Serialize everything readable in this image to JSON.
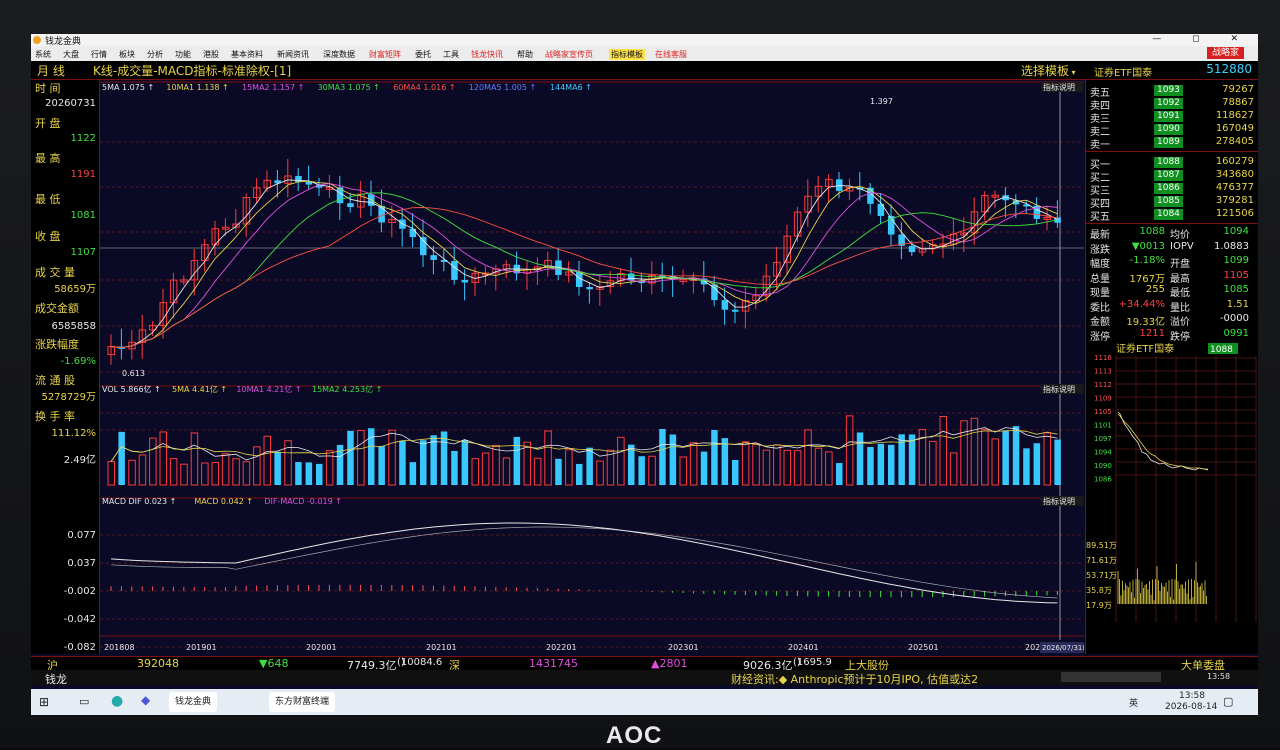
{
  "app": {
    "title": "钱龙金典",
    "window_controls": "— ◻ ✕"
  },
  "menu": {
    "items": [
      "系统",
      "大盘",
      "行情",
      "板块",
      "分析",
      "功能",
      "港股",
      "基本资料",
      "新闻资讯",
      "深度数据"
    ],
    "red_items": [
      "财富矩阵",
      "委托",
      "工具",
      "钱龙快讯",
      "帮助",
      "战略家宣传页"
    ],
    "highlighted": "指标模板",
    "extra": "在线客服",
    "login_label": "战略家"
  },
  "header": {
    "period": "月 线",
    "chart_title": "K线-成交量-MACD指标-标准除权-[1]",
    "template_label": "选择模板",
    "security_name": "证券ETF国泰",
    "security_code": "512880"
  },
  "ma_legend": [
    {
      "label": "5MA 1.075",
      "color": "#e8e8e8"
    },
    {
      "label": "10MA1 1.138",
      "color": "#e8d44a"
    },
    {
      "label": "15MA2 1.157",
      "color": "#e050e0"
    },
    {
      "label": "30MA3 1.075",
      "color": "#40e040"
    },
    {
      "label": "60MA4 1.016",
      "color": "#ff5040"
    },
    {
      "label": "120MA5 1.005",
      "color": "#6080ff"
    },
    {
      "label": "144MA6",
      "color": "#40c8ff"
    }
  ],
  "price_marks": {
    "high_label": "1.397",
    "low_label": "0.613"
  },
  "volume_legend": [
    {
      "label": "VOL 5.866亿",
      "color": "#e8e8e8"
    },
    {
      "label": "5MA 4.41亿",
      "color": "#e8d44a"
    },
    {
      "label": "10MA1 4.21亿",
      "color": "#e050e0"
    },
    {
      "label": "15MA2 4.253亿",
      "color": "#40e040"
    }
  ],
  "volume_axis": "2.49亿",
  "macd_legend": [
    {
      "label": "MACD DIF 0.023",
      "color": "#e8e8e8"
    },
    {
      "label": "MACD 0.042",
      "color": "#e8d44a"
    },
    {
      "label": "DIF-MACD -0.019",
      "color": "#e050e0"
    }
  ],
  "macd_axis": [
    "0.077",
    "0.037",
    "-0.002",
    "-0.042",
    "-0.082"
  ],
  "indicator_tag": "指标说明",
  "x_labels": [
    "201808",
    "201901",
    "202001",
    "202101",
    "202201",
    "202301",
    "202401",
    "202501",
    "202"
  ],
  "cursor_date": "2026/07/31(五)",
  "left_panel": {
    "time_label": "时 间",
    "time_value": "20260731",
    "open_label": "开 盘",
    "open_value": "1122",
    "high_label": "最 高",
    "high_value": "1191",
    "low_label": "最 低",
    "low_value": "1081",
    "close_label": "收 盘",
    "close_value": "1107",
    "volume_label": "成 交 量",
    "volume_value": "58659万",
    "amount_label": "成交金额",
    "amount_value": "6585858",
    "change_label": "涨跌幅度",
    "change_value": "-1.69%",
    "float_label": "流 通 股",
    "float_value": "5278729万",
    "turnover_label": "换 手 率",
    "turnover_value": "111.12%"
  },
  "order_book": {
    "sells": [
      {
        "name": "卖五",
        "price": "1093",
        "qty": "79267"
      },
      {
        "name": "卖四",
        "price": "1092",
        "qty": "78867"
      },
      {
        "name": "卖三",
        "price": "1091",
        "qty": "118627"
      },
      {
        "name": "卖二",
        "price": "1090",
        "qty": "167049"
      },
      {
        "name": "卖一",
        "price": "1089",
        "qty": "278405"
      }
    ],
    "buys": [
      {
        "name": "买一",
        "price": "1088",
        "qty": "160279"
      },
      {
        "name": "买二",
        "price": "1087",
        "qty": "343680"
      },
      {
        "name": "买三",
        "price": "1086",
        "qty": "476377"
      },
      {
        "name": "买四",
        "price": "1085",
        "qty": "379281"
      },
      {
        "name": "买五",
        "price": "1084",
        "qty": "121506"
      }
    ]
  },
  "quote_stats": [
    {
      "l1": "最新",
      "v1": "1088",
      "c1": "#40e040",
      "l2": "均价",
      "v2": "1094",
      "c2": "#40e040"
    },
    {
      "l1": "涨跌",
      "v1": "▼0013",
      "c1": "#40e040",
      "l2": "IOPV",
      "v2": "1.0883",
      "c2": "#e8e8e8"
    },
    {
      "l1": "幅度",
      "v1": "-1.18%",
      "c1": "#40e040",
      "l2": "开盘",
      "v2": "1099",
      "c2": "#40e040"
    },
    {
      "l1": "总量",
      "v1": "1767万",
      "c1": "#e8d44a",
      "l2": "最高",
      "v2": "1105",
      "c2": "#ff4040"
    },
    {
      "l1": "现量",
      "v1": "255",
      "c1": "#e8d44a",
      "l2": "最低",
      "v2": "1085",
      "c2": "#40e040"
    },
    {
      "l1": "委比",
      "v1": "+34.44%",
      "c1": "#ff4040",
      "l2": "量比",
      "v2": "1.51",
      "c2": "#e8d44a"
    },
    {
      "l1": "金额",
      "v1": "19.33亿",
      "c1": "#e8d44a",
      "l2": "溢价",
      "v2": "-0000",
      "c2": "#e8e8e8"
    },
    {
      "l1": "涨停",
      "v1": "1211",
      "c1": "#ff4040",
      "l2": "跌停",
      "v2": "0991",
      "c2": "#40e040"
    }
  ],
  "mini_chart": {
    "title": "证券ETF国泰",
    "price": "1088",
    "price_axis": [
      "1116",
      "1113",
      "1112",
      "1109",
      "1105",
      "1101",
      "1097",
      "1094",
      "1090",
      "1086"
    ],
    "vol_axis": [
      "89.51万",
      "71.61万",
      "53.71万",
      "35.8万",
      "17.9万"
    ]
  },
  "index_strip": {
    "sh_label": "沪",
    "sh_value": "392048",
    "sh_change": "▼648",
    "sh_amount": "7749.3亿",
    "sh_amount2": "10084.6亿",
    "sz_label": "深",
    "sz_value": "1431745",
    "sz_change": "▲2801",
    "sz_amount": "9026.3亿",
    "sz_amount2": "1695.9亿",
    "stock_name": "上大股份",
    "big_order": "大单委盘"
  },
  "news_strip": {
    "logo": "钱龙",
    "text": "财经资讯:◆ Anthropic预计于10月IPO, 估值或达2"
  },
  "taskbar": {
    "app1": "钱龙金典",
    "app2": "东方财富终端",
    "lang": "英",
    "time": "13:58",
    "date": "2026-08-14",
    "clock2": "13:58"
  },
  "bezel_brand": "AOC"
}
